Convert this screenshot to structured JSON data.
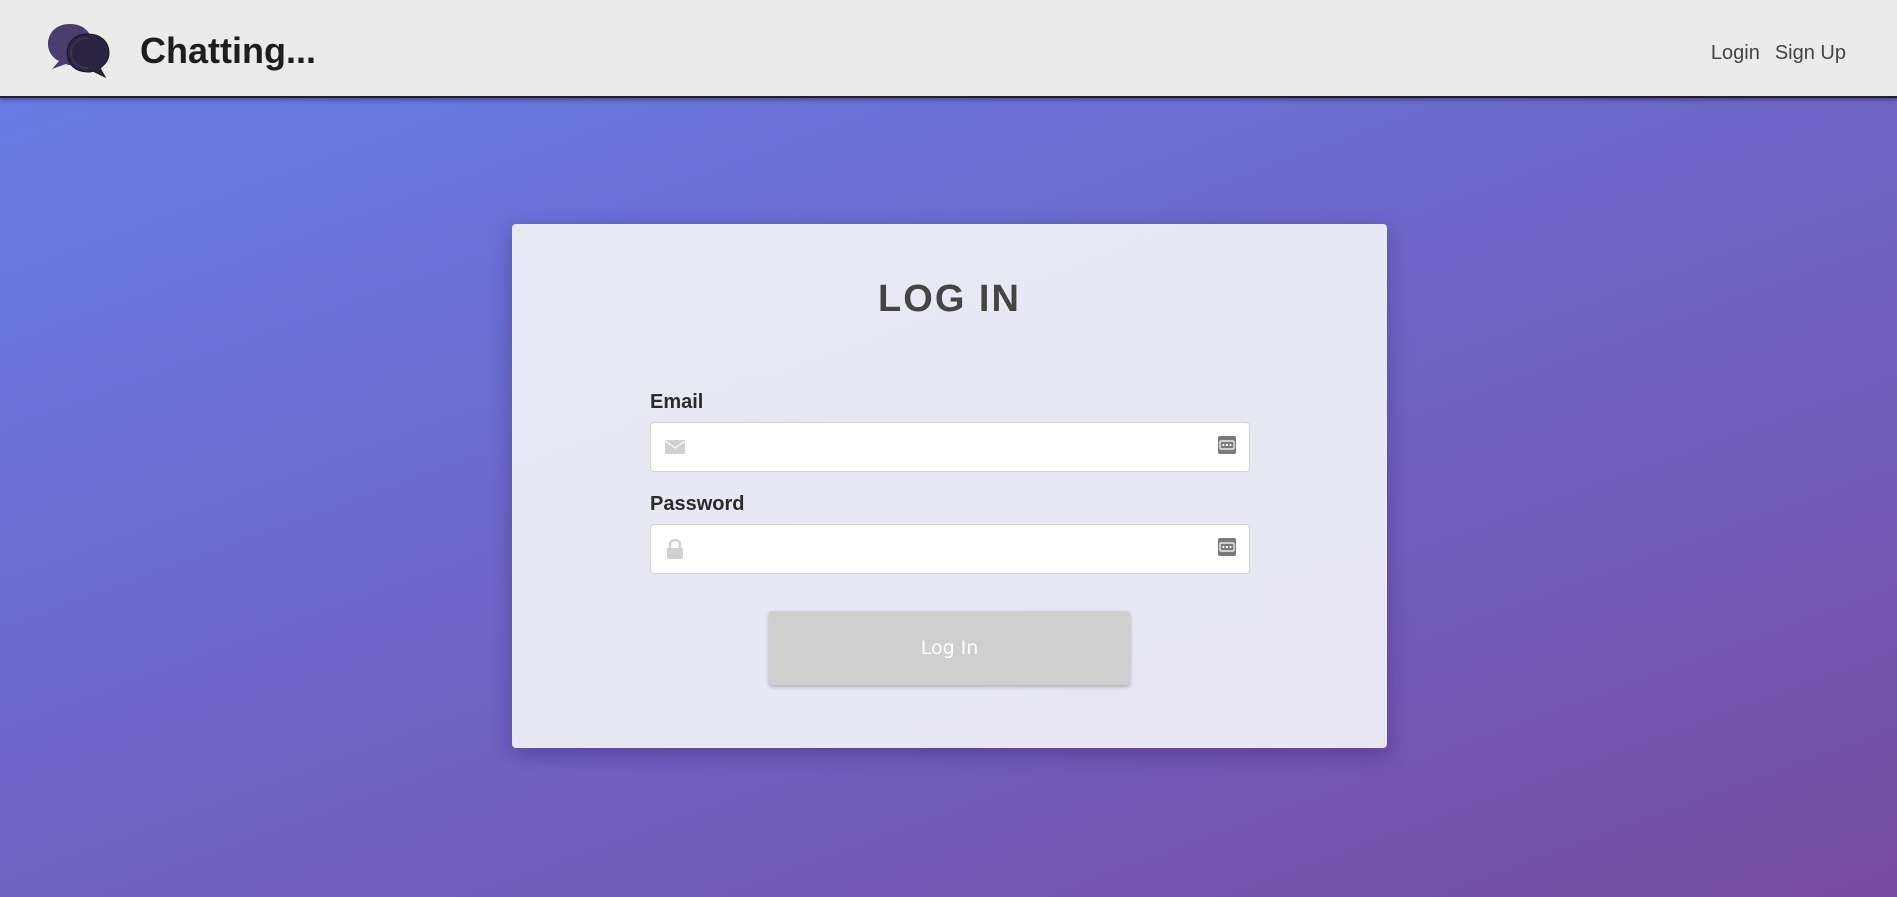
{
  "navbar": {
    "brand": "Chatting...",
    "logo_icon": "chat-bubbles-icon",
    "links": [
      {
        "label": "Login"
      },
      {
        "label": "Sign Up"
      }
    ]
  },
  "login_form": {
    "title": "LOG IN",
    "email": {
      "label": "Email",
      "value": "",
      "placeholder": "",
      "icon": "envelope-icon",
      "autofill_icon": "password-manager-icon"
    },
    "password": {
      "label": "Password",
      "value": "",
      "placeholder": "",
      "icon": "lock-icon",
      "autofill_icon": "password-manager-icon"
    },
    "submit_label": "Log In"
  },
  "colors": {
    "background_gradient_start": "#667eea",
    "background_gradient_end": "#764ba2",
    "navbar_bg": "#ebebeb",
    "card_bg": "#e9e9f6",
    "button_bg": "#cfcfcf",
    "logo_dark": "#2a2440",
    "logo_light": "#4b3d6e"
  }
}
